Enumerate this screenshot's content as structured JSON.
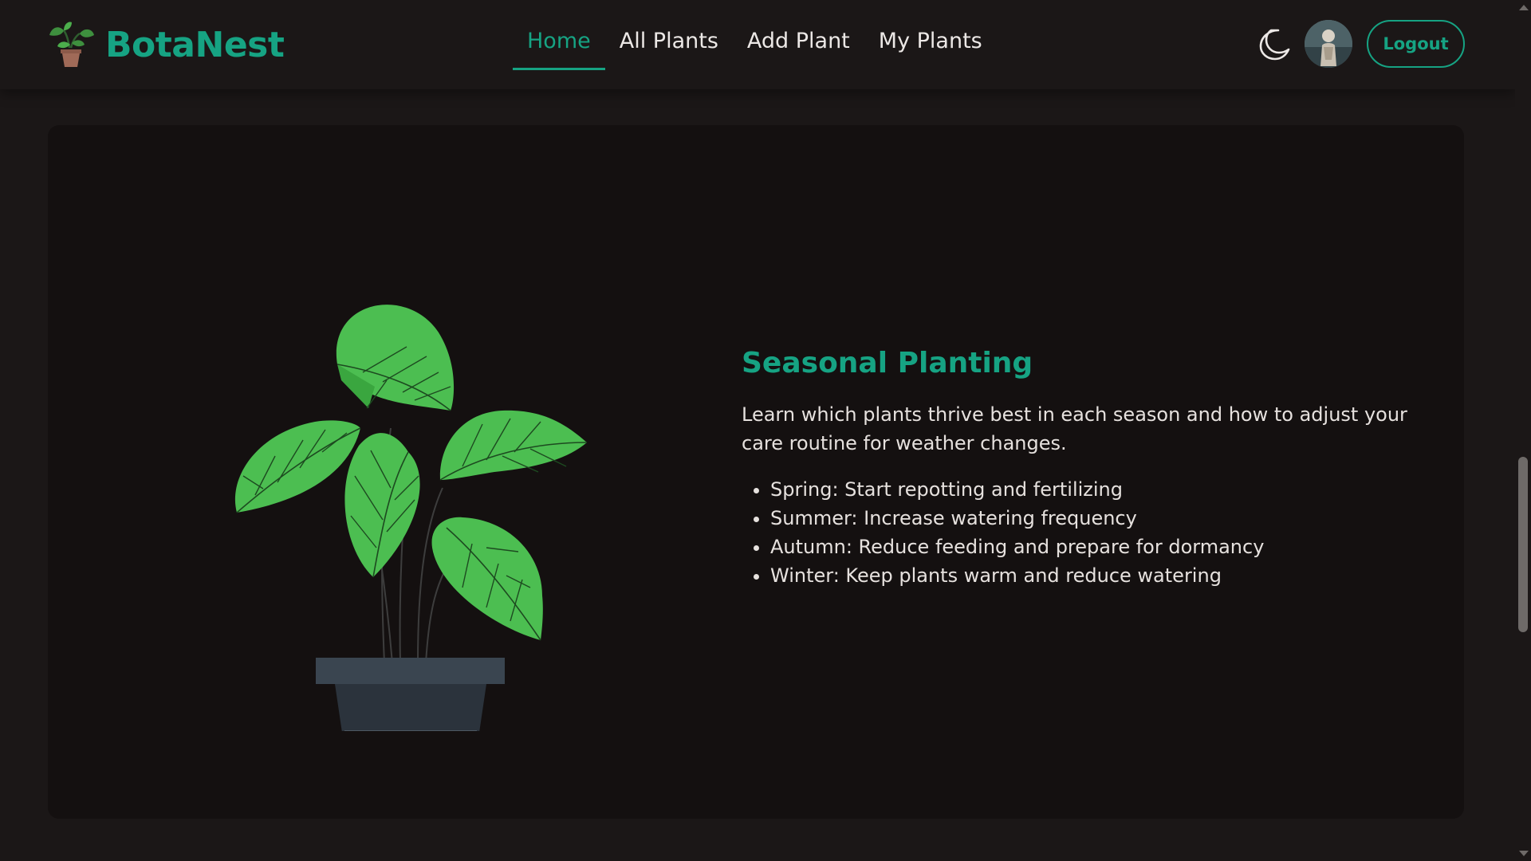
{
  "nav": {
    "brand": "BotaNest",
    "links": [
      "Home",
      "All Plants",
      "Add Plant",
      "My Plants"
    ],
    "active_link": "Home",
    "logout_label": "Logout",
    "theme_icon": "moon-icon",
    "logo_icon": "plant-pot-icon"
  },
  "hero": {
    "title": "Seasonal Planting",
    "description": "Learn which plants thrive best in each season and how to adjust your care routine for weather changes.",
    "tips": [
      "Spring: Start repotting and fertilizing",
      "Summer: Increase watering frequency",
      "Autumn: Reduce feeding and prepare for dormancy",
      "Winter: Keep plants warm and reduce watering"
    ]
  },
  "colors": {
    "accent": "#16a383",
    "background": "#1b1717",
    "card": "#141010",
    "leaf": "#4cbe51"
  }
}
